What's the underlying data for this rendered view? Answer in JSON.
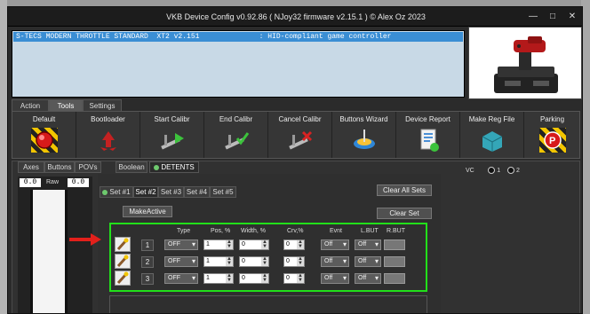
{
  "window": {
    "title": "VKB Device Config v0.92.86 ( NJoy32 firmware v2.15.1 ) © Alex Oz 2023",
    "minimize_label": "—",
    "maximize_label": "□",
    "close_label": "✕"
  },
  "device_list": {
    "selected_row": "S-TECS MODERN THROTTLE STANDARD  XT2 v2.151              : HID-compliant game controller"
  },
  "main_tabs": [
    "Action",
    "Tools",
    "Settings"
  ],
  "active_main_tab": "Tools",
  "tools": [
    {
      "label": "Default",
      "icon": "red-button-icon"
    },
    {
      "label": "Bootloader",
      "icon": "recycle-icon"
    },
    {
      "label": "Start Calibr",
      "icon": "caliper-play-icon"
    },
    {
      "label": "End Calibr",
      "icon": "caliper-check-icon"
    },
    {
      "label": "Cancel Calibr",
      "icon": "caliper-cancel-icon"
    },
    {
      "label": "Buttons Wizard",
      "icon": "wizard-icon"
    },
    {
      "label": "Device Report",
      "icon": "report-icon"
    },
    {
      "label": "Make Reg File",
      "icon": "reg-file-icon"
    },
    {
      "label": "Parking",
      "icon": "parking-icon"
    }
  ],
  "sub_tabs": [
    "Axes",
    "Buttons",
    "POVs",
    "Boolean",
    "DETENTS"
  ],
  "active_sub_tab": "DETENTS",
  "vc": {
    "label": "VC",
    "option1": "1",
    "option2": "2"
  },
  "axis_panel": {
    "left_value": "0.0",
    "raw_label": "Raw",
    "right_value": "0.0"
  },
  "set_tabs": [
    "Set #1",
    "Set #2",
    "Set #3",
    "Set #4",
    "Set #5"
  ],
  "active_set_tab": "Set #2",
  "buttons": {
    "clear_all_sets": "Clear All Sets",
    "make_active": "MakeActive",
    "clear_set": "Clear Set"
  },
  "table_headers": [
    "Type",
    "Pos, %",
    "Width, %",
    "Crv,%",
    "Evnt",
    "L.BUT",
    "R.BUT"
  ],
  "detent_rows": [
    {
      "num": "1",
      "type": "OFF",
      "pos": "1",
      "width": "0",
      "crv": "0",
      "evnt": "Off",
      "lbut": "Off"
    },
    {
      "num": "2",
      "type": "OFF",
      "pos": "1",
      "width": "0",
      "crv": "0",
      "evnt": "Off",
      "lbut": "Off"
    },
    {
      "num": "3",
      "type": "OFF",
      "pos": "1",
      "width": "0",
      "crv": "0",
      "evnt": "Off",
      "lbut": "Off"
    }
  ],
  "colors": {
    "highlight_green": "#22e01a",
    "arrow_red": "#e3201b",
    "selection_blue": "#3a8ed4"
  }
}
